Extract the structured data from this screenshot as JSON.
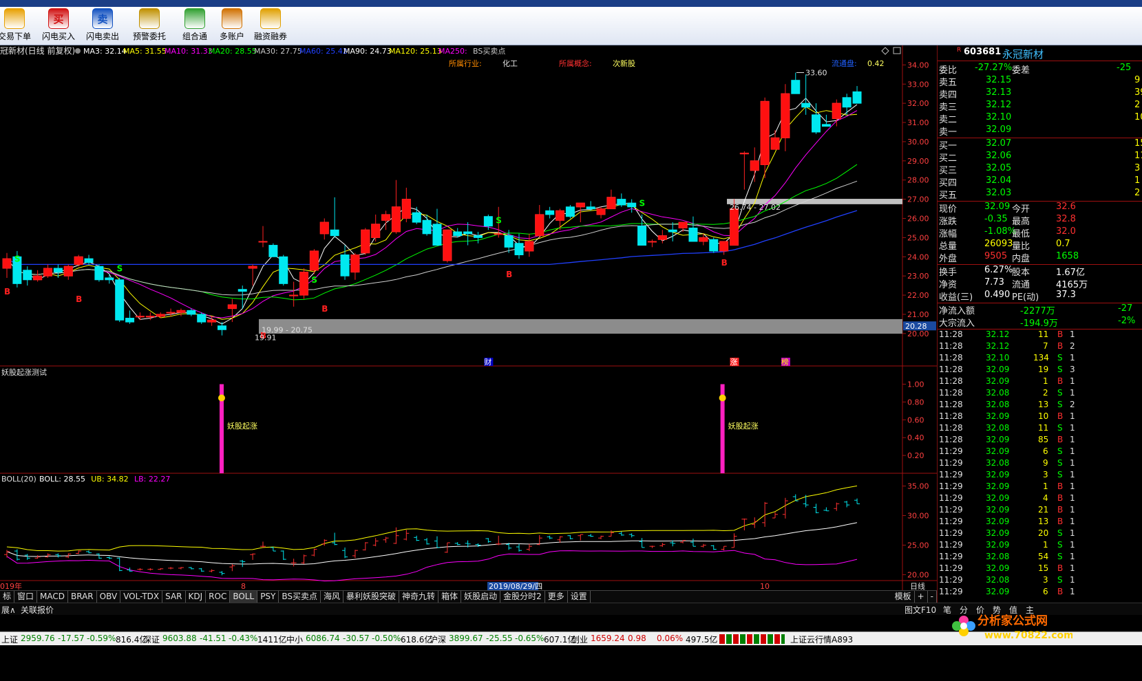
{
  "toolbar": {
    "buttons": [
      {
        "label": "交易下单",
        "icon": "trade-icon",
        "color": "#e8a000"
      },
      {
        "label": "闪电买入",
        "icon": "buy-icon",
        "glyph": "买",
        "color": "#d01010"
      },
      {
        "label": "闪电卖出",
        "icon": "sell-icon",
        "glyph": "卖",
        "color": "#1050c0"
      },
      {
        "label": "预警委托",
        "icon": "alert-icon",
        "color": "#c09000"
      },
      {
        "label": "组合通",
        "icon": "puzzle-icon",
        "color": "#30a030"
      },
      {
        "label": "多账户",
        "icon": "accounts-icon",
        "color": "#d07000"
      },
      {
        "label": "融资融券",
        "icon": "margin-icon",
        "color": "#e0a000"
      }
    ]
  },
  "chart_header": {
    "title": "冠新材(日线 前复权)",
    "ma": [
      {
        "label": "MA3: 32.14",
        "color": "#ffffff"
      },
      {
        "label": "MA5: 31.55",
        "color": "#ffff00"
      },
      {
        "label": "MA10: 31.33",
        "color": "#ff00ff"
      },
      {
        "label": "MA20: 28.55",
        "color": "#00ff00"
      },
      {
        "label": "MA30: 27.75",
        "color": "#c8c8c8"
      },
      {
        "label": "MA60: 25.42",
        "color": "#2040ff"
      },
      {
        "label": "MA90: 24.73",
        "color": "#ffffff"
      },
      {
        "label": "MA120: 25.13",
        "color": "#ffff00"
      },
      {
        "label": "MA250:",
        "color": "#ff00ff"
      },
      {
        "label": "BS买卖点",
        "color": "#c8c8c8"
      }
    ],
    "industry_label": "所属行业:",
    "industry": "化工",
    "concept_label": "所属概念:",
    "concept": "次新股",
    "float_label": "流通盘:",
    "float_value": "0.42"
  },
  "chart_data": [
    {
      "type": "candlestick",
      "title": "冠新材(日线 前复权)",
      "x_labels": [
        "019年",
        "8",
        "2019/08/29/四",
        "10"
      ],
      "y_ticks": [
        34,
        33,
        32,
        31,
        30,
        29,
        28,
        27,
        26,
        25,
        24,
        23,
        22,
        21,
        20
      ],
      "ylim": [
        19.6,
        34.3
      ],
      "candles": [
        [
          23.4,
          24.2,
          22.9,
          23.9
        ],
        [
          24.0,
          24.3,
          22.4,
          22.6
        ],
        [
          23.3,
          23.5,
          22.5,
          22.8
        ],
        [
          22.8,
          23.3,
          22.7,
          23.0
        ],
        [
          23.0,
          23.6,
          22.9,
          23.4
        ],
        [
          23.4,
          23.6,
          22.9,
          23.2
        ],
        [
          23.0,
          23.6,
          22.8,
          23.5
        ],
        [
          23.6,
          24.1,
          23.5,
          24.0
        ],
        [
          23.9,
          24.1,
          23.6,
          23.7
        ],
        [
          23.5,
          23.6,
          22.7,
          22.8
        ],
        [
          22.9,
          23.1,
          22.6,
          22.8
        ],
        [
          22.8,
          22.9,
          20.6,
          20.7
        ],
        [
          20.8,
          21.2,
          20.5,
          20.6
        ],
        [
          20.9,
          21.1,
          20.7,
          20.9
        ],
        [
          20.9,
          21.1,
          20.7,
          20.9
        ],
        [
          20.9,
          21.1,
          20.8,
          21.0
        ],
        [
          21.1,
          21.3,
          20.9,
          21.1
        ],
        [
          21.1,
          21.3,
          20.9,
          21.2
        ],
        [
          21.2,
          21.3,
          20.9,
          21.0
        ],
        [
          21.0,
          21.1,
          20.5,
          20.6
        ],
        [
          20.6,
          20.9,
          20.4,
          20.7
        ],
        [
          20.4,
          20.6,
          19.9,
          20.2
        ],
        [
          21.3,
          21.8,
          20.6,
          21.5
        ],
        [
          22.3,
          22.5,
          21.3,
          22.2
        ],
        [
          23.4,
          23.6,
          22.5,
          23.5
        ],
        [
          24.8,
          25.6,
          24.5,
          24.8
        ],
        [
          24.6,
          24.7,
          24.0,
          24.0
        ],
        [
          24.0,
          24.1,
          22.5,
          22.6
        ],
        [
          22.0,
          22.7,
          21.4,
          22.0
        ],
        [
          22.0,
          23.4,
          21.8,
          23.2
        ],
        [
          23.3,
          24.4,
          23.1,
          24.3
        ],
        [
          25.2,
          26.0,
          24.9,
          25.8
        ],
        [
          25.4,
          27.1,
          25.0,
          25.1
        ],
        [
          24.1,
          24.6,
          22.8,
          23.0
        ],
        [
          23.2,
          24.2,
          22.8,
          24.1
        ],
        [
          24.2,
          25.5,
          24.1,
          25.4
        ],
        [
          25.0,
          26.2,
          24.8,
          25.7
        ],
        [
          25.9,
          26.4,
          25.4,
          26.2
        ],
        [
          25.3,
          28.0,
          25.2,
          26.6
        ],
        [
          26.0,
          27.6,
          25.8,
          27.0
        ],
        [
          26.3,
          26.6,
          25.7,
          25.8
        ],
        [
          25.9,
          26.2,
          25.1,
          25.2
        ],
        [
          25.7,
          26.5,
          24.6,
          24.6
        ],
        [
          23.8,
          25.4,
          23.7,
          25.4
        ],
        [
          25.3,
          25.5,
          25.0,
          25.1
        ],
        [
          25.3,
          25.8,
          24.6,
          25.2
        ],
        [
          25.1,
          25.3,
          24.7,
          25.0
        ],
        [
          26.1,
          26.2,
          25.4,
          25.6
        ],
        [
          25.2,
          26.6,
          25.0,
          25.2
        ],
        [
          25.1,
          25.4,
          24.2,
          24.5
        ],
        [
          24.7,
          25.2,
          23.9,
          24.1
        ],
        [
          24.3,
          25.2,
          24.0,
          24.8
        ],
        [
          25.1,
          26.7,
          25.0,
          26.2
        ],
        [
          26.4,
          26.6,
          26.0,
          26.2
        ],
        [
          25.9,
          26.5,
          25.4,
          26.4
        ],
        [
          26.6,
          26.7,
          26.0,
          26.1
        ],
        [
          26.6,
          26.8,
          25.8,
          26.8
        ],
        [
          26.6,
          26.9,
          26.4,
          26.5
        ],
        [
          26.2,
          26.6,
          26.0,
          26.5
        ],
        [
          26.5,
          27.5,
          26.5,
          27.1
        ],
        [
          27.0,
          27.3,
          26.6,
          26.7
        ],
        [
          26.8,
          27.0,
          26.3,
          26.6
        ],
        [
          25.6,
          26.2,
          24.6,
          24.6
        ],
        [
          24.8,
          24.9,
          24.5,
          24.8
        ],
        [
          24.9,
          25.4,
          24.7,
          25.1
        ],
        [
          25.4,
          25.8,
          24.8,
          25.3
        ],
        [
          25.5,
          25.8,
          25.3,
          25.8
        ],
        [
          25.5,
          26.1,
          24.8,
          24.8
        ],
        [
          24.8,
          25.2,
          24.6,
          25.0
        ],
        [
          24.9,
          25.0,
          24.2,
          24.3
        ],
        [
          24.3,
          24.8,
          24.1,
          24.8
        ],
        [
          24.6,
          27.0,
          24.6,
          26.5
        ],
        [
          29.4,
          29.5,
          27.5,
          29.4
        ],
        [
          28.5,
          29.7,
          27.9,
          29.0
        ],
        [
          28.8,
          32.3,
          28.1,
          32.1
        ],
        [
          29.6,
          30.6,
          29.6,
          30.2
        ],
        [
          30.2,
          33.0,
          29.5,
          32.5
        ],
        [
          33.2,
          33.6,
          32.5,
          32.5
        ],
        [
          32.0,
          33.5,
          31.4,
          31.8
        ],
        [
          31.4,
          32.0,
          30.4,
          30.5
        ],
        [
          30.9,
          31.4,
          30.8,
          30.8
        ],
        [
          31.2,
          32.2,
          30.8,
          32.0
        ],
        [
          32.3,
          32.5,
          31.4,
          31.8
        ],
        [
          32.6,
          32.9,
          32.0,
          32.0
        ]
      ],
      "annotations": [
        "33.60",
        "19.91",
        "19.99 - 20.75",
        "26.74 - 27.02",
        "20.28"
      ],
      "signals": {
        "buy": "B",
        "sell": "S"
      },
      "markers": [
        "财",
        "涨",
        "榜"
      ]
    },
    {
      "type": "bar",
      "title": "妖股起涨测试",
      "y_ticks": [
        1.0,
        0.8,
        0.6,
        0.4,
        0.2
      ],
      "ylim": [
        0,
        1.05
      ],
      "x_index": [
        21,
        70
      ],
      "values": [
        1,
        1
      ],
      "annotation": "妖股起涨"
    },
    {
      "type": "line",
      "title": "BOLL(20)",
      "legend": [
        {
          "label": "BOLL: 28.55",
          "color": "#ffffff"
        },
        {
          "label": "UB: 34.82",
          "color": "#ffff00"
        },
        {
          "label": "LB: 22.27",
          "color": "#ff00ff"
        }
      ],
      "y_ticks": [
        35.0,
        30.0,
        25.0,
        20.0
      ],
      "ylim": [
        19,
        36
      ]
    }
  ],
  "right_panel": {
    "code": "603681",
    "name": "永冠新材",
    "marker": "R",
    "ratio": [
      {
        "l": "委比",
        "v": "-27.27%",
        "l2": "委差",
        "v2": "-25"
      }
    ],
    "asks": [
      {
        "l": "卖五",
        "p": "32.15",
        "v": "9"
      },
      {
        "l": "卖四",
        "p": "32.13",
        "v": "39"
      },
      {
        "l": "卖三",
        "p": "32.12",
        "v": "2"
      },
      {
        "l": "卖二",
        "p": "32.10",
        "v": "10"
      },
      {
        "l": "卖一",
        "p": "32.09",
        "v": ""
      }
    ],
    "bids": [
      {
        "l": "买一",
        "p": "32.07",
        "v": "15"
      },
      {
        "l": "买二",
        "p": "32.06",
        "v": "11"
      },
      {
        "l": "买三",
        "p": "32.05",
        "v": "3"
      },
      {
        "l": "买四",
        "p": "32.04",
        "v": "1"
      },
      {
        "l": "买五",
        "p": "32.03",
        "v": "2"
      }
    ],
    "stats": [
      {
        "l": "现价",
        "v": "32.09",
        "l2": "今开",
        "v2": "32.6",
        "c": "#00ff00",
        "c2": "#ff3030"
      },
      {
        "l": "涨跌",
        "v": "-0.35",
        "l2": "最高",
        "v2": "32.8",
        "c": "#00ff00",
        "c2": "#ff3030"
      },
      {
        "l": "涨幅",
        "v": "-1.08%",
        "l2": "最低",
        "v2": "32.0",
        "c": "#00ff00",
        "c2": "#ff3030"
      },
      {
        "l": "总量",
        "v": "26093",
        "l2": "量比",
        "v2": "0.7",
        "c": "#ffff00",
        "c2": "#ffff00"
      },
      {
        "l": "外盘",
        "v": "9505",
        "l2": "内盘",
        "v2": "1658",
        "c": "#ff3030",
        "c2": "#00ff00"
      },
      {
        "l": "换手",
        "v": "6.27%",
        "l2": "股本",
        "v2": "1.67亿",
        "c": "#ffffff",
        "c2": "#ffffff"
      },
      {
        "l": "净资",
        "v": "7.73",
        "l2": "流通",
        "v2": "4165万",
        "c": "#ffffff",
        "c2": "#ffffff"
      },
      {
        "l": "收益(三)",
        "v": "0.490",
        "l2": "PE(动)",
        "v2": "37.3",
        "c": "#ffffff",
        "c2": "#ffffff"
      }
    ],
    "flows": [
      {
        "l": "净流入额",
        "v": "-2277万",
        "v2": "-27"
      },
      {
        "l": "大宗流入",
        "v": "-194.9万",
        "v2": "-2%"
      }
    ],
    "ticks": [
      [
        "11:28",
        "32.12",
        "11",
        "B",
        "1"
      ],
      [
        "11:28",
        "32.12",
        "7",
        "B",
        "2"
      ],
      [
        "11:28",
        "32.10",
        "134",
        "S",
        "1"
      ],
      [
        "11:28",
        "32.09",
        "19",
        "S",
        "3"
      ],
      [
        "11:28",
        "32.09",
        "1",
        "B",
        "1"
      ],
      [
        "11:28",
        "32.08",
        "2",
        "S",
        "1"
      ],
      [
        "11:28",
        "32.08",
        "13",
        "S",
        "2"
      ],
      [
        "11:28",
        "32.09",
        "10",
        "B",
        "1"
      ],
      [
        "11:28",
        "32.08",
        "11",
        "S",
        "1"
      ],
      [
        "11:28",
        "32.09",
        "85",
        "B",
        "1"
      ],
      [
        "11:29",
        "32.09",
        "6",
        "S",
        "1"
      ],
      [
        "11:29",
        "32.08",
        "9",
        "S",
        "1"
      ],
      [
        "11:29",
        "32.09",
        "3",
        "S",
        "1"
      ],
      [
        "11:29",
        "32.09",
        "1",
        "B",
        "1"
      ],
      [
        "11:29",
        "32.09",
        "4",
        "B",
        "1"
      ],
      [
        "11:29",
        "32.09",
        "21",
        "B",
        "1"
      ],
      [
        "11:29",
        "32.09",
        "13",
        "B",
        "1"
      ],
      [
        "11:29",
        "32.09",
        "20",
        "S",
        "1"
      ],
      [
        "11:29",
        "32.09",
        "1",
        "S",
        "1"
      ],
      [
        "11:29",
        "32.08",
        "54",
        "S",
        "1"
      ],
      [
        "11:29",
        "32.09",
        "15",
        "B",
        "1"
      ],
      [
        "11:29",
        "32.08",
        "3",
        "S",
        "1"
      ],
      [
        "11:29",
        "32.09",
        "6",
        "B",
        "1"
      ]
    ]
  },
  "tabs": [
    "标",
    "窗口",
    "MACD",
    "BRAR",
    "OBV",
    "VOL-TDX",
    "SAR",
    "KDJ",
    "ROC",
    "BOLL",
    "PSY",
    "BS买卖点",
    "海风",
    "暴利妖股突破",
    "神奇九转",
    "箱体",
    "妖股启动",
    "金股分时2",
    "更多",
    "设置"
  ],
  "tabs_right": {
    "board": "模板",
    "plus": "+",
    "minus": "-"
  },
  "period": "日线",
  "link_bar": {
    "left1": "展∧",
    "left2": "关联报价",
    "right": "图文F10",
    "chips": [
      "笔",
      "分",
      "价",
      "势",
      "值",
      "主"
    ]
  },
  "status_bar": [
    {
      "name": "上证",
      "v": "2959.76",
      "c": "-17.57",
      "p": "-0.59%",
      "a": "816.4亿"
    },
    {
      "name": "深证",
      "v": "9603.88",
      "c": "-41.51",
      "p": "-0.43%",
      "a": "1411亿"
    },
    {
      "name": "中小",
      "v": "6086.74",
      "c": "-30.57",
      "p": "-0.50%",
      "a": "618.6亿"
    },
    {
      "name": "沪深",
      "v": "3899.67",
      "c": "-25.55",
      "p": "-0.65%",
      "a": "607.1亿"
    },
    {
      "name": "创业",
      "v": "1659.24",
      "c": "0.98",
      "p": "0.06%",
      "a": "497.5亿"
    }
  ],
  "status_right": "上证云行情A893",
  "watermark": {
    "cn": "分析家公式网",
    "url": "www.70822.com"
  }
}
